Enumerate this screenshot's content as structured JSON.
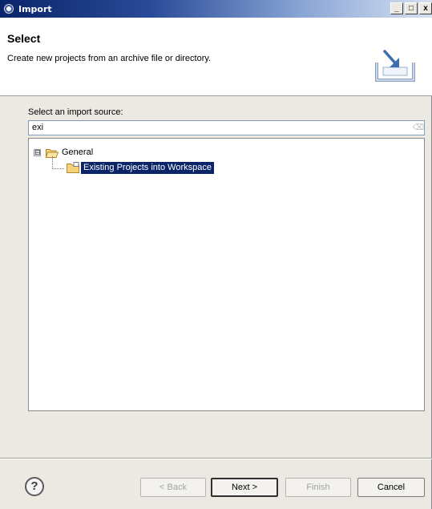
{
  "window": {
    "title": "Import",
    "controls": {
      "minimize": "_",
      "maximize": "□",
      "close": "x"
    }
  },
  "banner": {
    "heading": "Select",
    "description": "Create new projects from an archive file or directory.",
    "icon": "import-wizard-icon"
  },
  "source": {
    "label": "Select an import source:",
    "filter_value": "exi",
    "clear_icon": "eraser-icon"
  },
  "tree": {
    "category": {
      "label": "General",
      "expander": "⊟",
      "icon": "folder-icon",
      "expanded": true
    },
    "items": [
      {
        "label": "Existing Projects into Workspace",
        "icon": "project-icon",
        "selected": true
      }
    ]
  },
  "buttons": {
    "help": "?",
    "back": "< Back",
    "next": "Next >",
    "finish": "Finish",
    "cancel": "Cancel"
  },
  "colors": {
    "selection": "#0a246a",
    "titlebar_start": "#0a246a"
  }
}
